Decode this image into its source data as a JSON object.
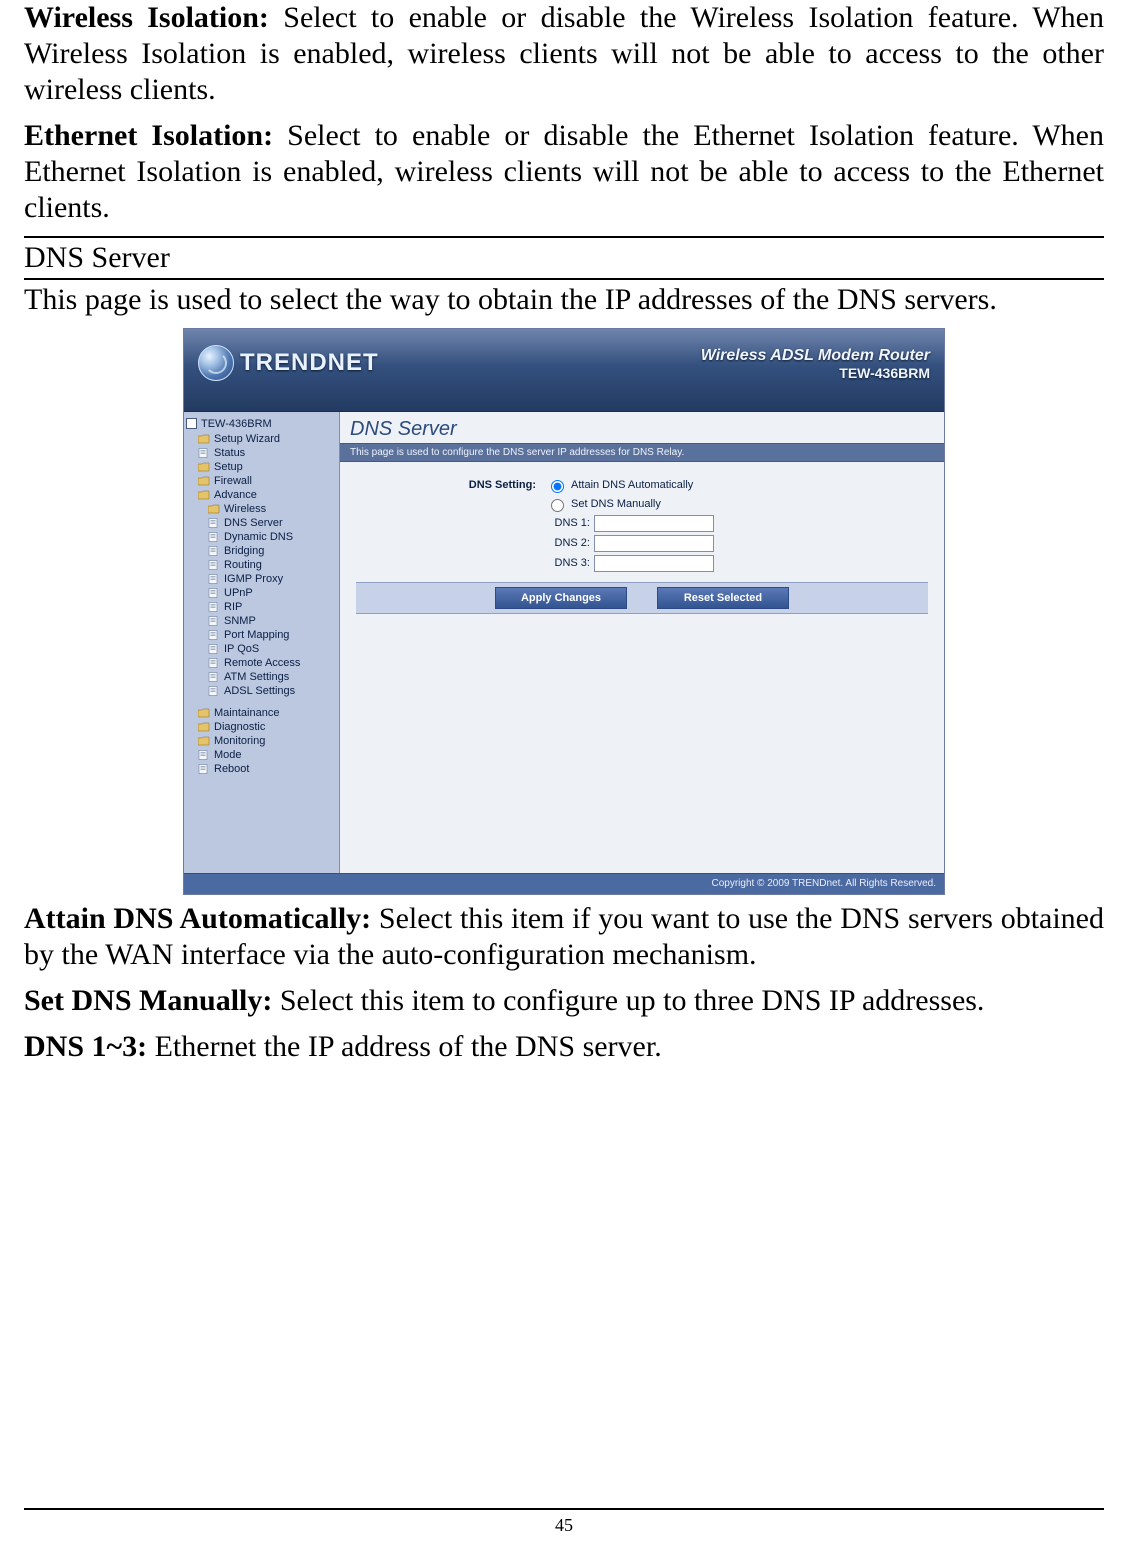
{
  "paragraphs": {
    "wireless_isolation_label": "Wireless Isolation:",
    "wireless_isolation_body": " Select to enable or disable the Wireless Isolation feature. When Wireless Isolation is enabled, wireless clients will not be able to access to the other wireless clients.",
    "ethernet_isolation_label": "Ethernet Isolation:",
    "ethernet_isolation_body": " Select to enable or disable the Ethernet Isolation feature. When Ethernet Isolation is enabled, wireless clients will not be able to access to the Ethernet clients.",
    "attain_dns_label": "Attain DNS Automatically:",
    "attain_dns_body": " Select this item if you want to use the DNS servers obtained by the WAN interface via the auto-configuration mechanism.",
    "set_dns_label": "Set DNS Manually:",
    "set_dns_body": " Select this item to configure up to three DNS IP addresses.",
    "dns13_label": "DNS 1~3:",
    "dns13_body": " Ethernet the IP address of the DNS server."
  },
  "section_heading": "DNS Server",
  "section_intro": "This page is used to select the way to obtain the IP addresses of the DNS servers.",
  "router": {
    "brand": "TRENDNET",
    "header_line1": "Wireless ADSL Modem Router",
    "header_line2": "TEW-436BRM",
    "panel_title": "DNS Server",
    "panel_desc": "This page is used to configure the DNS server IP addresses for DNS Relay.",
    "form": {
      "dns_setting_label": "DNS Setting:",
      "opt_attain": "Attain DNS Automatically",
      "opt_manual": "Set DNS Manually",
      "dns1_label": "DNS 1:",
      "dns2_label": "DNS 2:",
      "dns3_label": "DNS 3:",
      "dns1_value": "",
      "dns2_value": "",
      "dns3_value": "",
      "btn_apply": "Apply Changes",
      "btn_reset": "Reset Selected"
    },
    "sidebar": {
      "root": "TEW-436BRM",
      "items": [
        {
          "label": "Setup Wizard",
          "icon": "folder"
        },
        {
          "label": "Status",
          "icon": "page"
        },
        {
          "label": "Setup",
          "icon": "folder"
        },
        {
          "label": "Firewall",
          "icon": "folder"
        },
        {
          "label": "Advance",
          "icon": "folder-open"
        }
      ],
      "advance_children": [
        {
          "label": "Wireless",
          "icon": "folder"
        },
        {
          "label": "DNS Server",
          "icon": "page"
        },
        {
          "label": "Dynamic DNS",
          "icon": "page"
        },
        {
          "label": "Bridging",
          "icon": "page"
        },
        {
          "label": "Routing",
          "icon": "page"
        },
        {
          "label": "IGMP Proxy",
          "icon": "page"
        },
        {
          "label": "UPnP",
          "icon": "page"
        },
        {
          "label": "RIP",
          "icon": "page"
        },
        {
          "label": "SNMP",
          "icon": "page"
        },
        {
          "label": "Port Mapping",
          "icon": "page"
        },
        {
          "label": "IP QoS",
          "icon": "page"
        },
        {
          "label": "Remote Access",
          "icon": "page"
        },
        {
          "label": "ATM Settings",
          "icon": "page"
        },
        {
          "label": "ADSL Settings",
          "icon": "page"
        }
      ],
      "bottom_items": [
        {
          "label": "Maintainance",
          "icon": "folder"
        },
        {
          "label": "Diagnostic",
          "icon": "folder"
        },
        {
          "label": "Monitoring",
          "icon": "folder"
        },
        {
          "label": "Mode",
          "icon": "page"
        },
        {
          "label": "Reboot",
          "icon": "page"
        }
      ]
    },
    "footer": "Copyright © 2009 TRENDnet. All Rights Reserved."
  },
  "page_number": "45"
}
